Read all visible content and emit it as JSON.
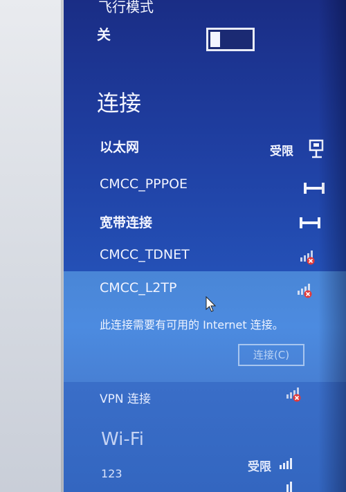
{
  "airplane_mode": {
    "label": "飞行模式",
    "state": "关"
  },
  "connections": {
    "title": "连接",
    "items": [
      {
        "name": "以太网",
        "status": "受限",
        "icon": "ethernet-icon"
      },
      {
        "name": "CMCC_PPPOE",
        "icon": "dialup-icon"
      },
      {
        "name": "宽带连接",
        "icon": "dialup-icon"
      },
      {
        "name": "CMCC_TDNET",
        "icon": "mobile-signal-error-icon"
      }
    ],
    "selected": {
      "name": "CMCC_L2TP",
      "icon": "mobile-signal-error-icon",
      "message": "此连接需要有可用的 Internet 连接。",
      "button": "连接(C)"
    },
    "vpn": {
      "name": "VPN 连接",
      "icon": "mobile-signal-error-icon"
    }
  },
  "wifi": {
    "title": "Wi-Fi",
    "networks": [
      {
        "name": "123",
        "status": "受限",
        "icon": "wifi-signal-icon"
      }
    ]
  },
  "colors": {
    "panel": "#1f3fa2",
    "selected_row": "#4c8be0",
    "text": "#f3f5ff",
    "error_badge": "#e23b3b"
  }
}
